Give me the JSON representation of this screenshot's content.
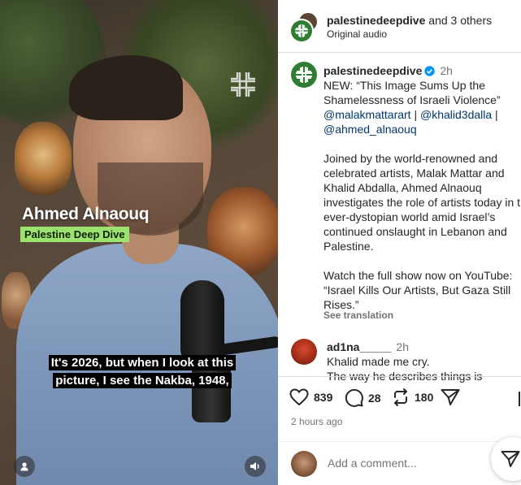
{
  "video": {
    "speaker_name": "Ahmed Alnaouq",
    "speaker_tag": "Palestine Deep Dive",
    "caption_line1": "It's 2026, but when I look at this",
    "caption_line2": "picture, I see the Nakba, 1948,",
    "colors": {
      "tag_bg": "#9be36e"
    }
  },
  "header": {
    "username": "palestinedeepdive",
    "others": " and 3 others",
    "audio": "Original audio"
  },
  "post": {
    "username": "palestinedeepdive",
    "time": "2h",
    "lines": [
      "NEW: “This Image Sums Up the",
      "Shameless­ness of Israeli Violence”"
    ],
    "mentions": [
      "@malakmattarart",
      "@khalid3dalla",
      "@ahmed_alnaouq"
    ],
    "mention_sep": " | ",
    "para2": [
      "Joined by the world-renowned and",
      "celebrated artists, Malak Mattar and",
      "Khalid Abdalla, Ahmed Alnaouq",
      "investigates the role of artists today in t",
      "ever-dystopian world amid Israel’s",
      "continued onslaught in Lebanon and",
      "Palestine."
    ],
    "para3": [
      "Watch the full show now on YouTube:",
      "“Israel Kills Our Artists, But Gaza Still",
      "Rises.”"
    ],
    "see_translation": "See translation"
  },
  "comment": {
    "username": "ad1na_____",
    "time": "2h",
    "line1": "Khalid made me cry.",
    "line2": "The way he describes things is"
  },
  "actions": {
    "likes": "839",
    "comments": "28",
    "reposts": "180",
    "posted_ago": "2 hours ago"
  },
  "add_comment": {
    "placeholder": "Add a comment..."
  },
  "colors": {
    "link": "#00376b",
    "verified": "#0095f6",
    "brand_green": "#2e7d32"
  }
}
